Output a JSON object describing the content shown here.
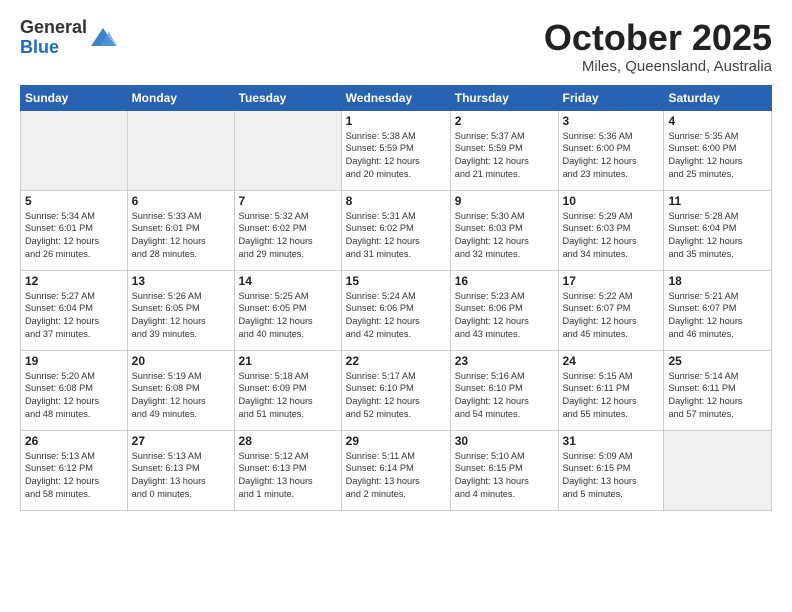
{
  "logo": {
    "general": "General",
    "blue": "Blue"
  },
  "header": {
    "month": "October 2025",
    "location": "Miles, Queensland, Australia"
  },
  "weekdays": [
    "Sunday",
    "Monday",
    "Tuesday",
    "Wednesday",
    "Thursday",
    "Friday",
    "Saturday"
  ],
  "weeks": [
    [
      {
        "day": "",
        "info": ""
      },
      {
        "day": "",
        "info": ""
      },
      {
        "day": "",
        "info": ""
      },
      {
        "day": "1",
        "info": "Sunrise: 5:38 AM\nSunset: 5:59 PM\nDaylight: 12 hours\nand 20 minutes."
      },
      {
        "day": "2",
        "info": "Sunrise: 5:37 AM\nSunset: 5:59 PM\nDaylight: 12 hours\nand 21 minutes."
      },
      {
        "day": "3",
        "info": "Sunrise: 5:36 AM\nSunset: 6:00 PM\nDaylight: 12 hours\nand 23 minutes."
      },
      {
        "day": "4",
        "info": "Sunrise: 5:35 AM\nSunset: 6:00 PM\nDaylight: 12 hours\nand 25 minutes."
      }
    ],
    [
      {
        "day": "5",
        "info": "Sunrise: 5:34 AM\nSunset: 6:01 PM\nDaylight: 12 hours\nand 26 minutes."
      },
      {
        "day": "6",
        "info": "Sunrise: 5:33 AM\nSunset: 6:01 PM\nDaylight: 12 hours\nand 28 minutes."
      },
      {
        "day": "7",
        "info": "Sunrise: 5:32 AM\nSunset: 6:02 PM\nDaylight: 12 hours\nand 29 minutes."
      },
      {
        "day": "8",
        "info": "Sunrise: 5:31 AM\nSunset: 6:02 PM\nDaylight: 12 hours\nand 31 minutes."
      },
      {
        "day": "9",
        "info": "Sunrise: 5:30 AM\nSunset: 6:03 PM\nDaylight: 12 hours\nand 32 minutes."
      },
      {
        "day": "10",
        "info": "Sunrise: 5:29 AM\nSunset: 6:03 PM\nDaylight: 12 hours\nand 34 minutes."
      },
      {
        "day": "11",
        "info": "Sunrise: 5:28 AM\nSunset: 6:04 PM\nDaylight: 12 hours\nand 35 minutes."
      }
    ],
    [
      {
        "day": "12",
        "info": "Sunrise: 5:27 AM\nSunset: 6:04 PM\nDaylight: 12 hours\nand 37 minutes."
      },
      {
        "day": "13",
        "info": "Sunrise: 5:26 AM\nSunset: 6:05 PM\nDaylight: 12 hours\nand 39 minutes."
      },
      {
        "day": "14",
        "info": "Sunrise: 5:25 AM\nSunset: 6:05 PM\nDaylight: 12 hours\nand 40 minutes."
      },
      {
        "day": "15",
        "info": "Sunrise: 5:24 AM\nSunset: 6:06 PM\nDaylight: 12 hours\nand 42 minutes."
      },
      {
        "day": "16",
        "info": "Sunrise: 5:23 AM\nSunset: 6:06 PM\nDaylight: 12 hours\nand 43 minutes."
      },
      {
        "day": "17",
        "info": "Sunrise: 5:22 AM\nSunset: 6:07 PM\nDaylight: 12 hours\nand 45 minutes."
      },
      {
        "day": "18",
        "info": "Sunrise: 5:21 AM\nSunset: 6:07 PM\nDaylight: 12 hours\nand 46 minutes."
      }
    ],
    [
      {
        "day": "19",
        "info": "Sunrise: 5:20 AM\nSunset: 6:08 PM\nDaylight: 12 hours\nand 48 minutes."
      },
      {
        "day": "20",
        "info": "Sunrise: 5:19 AM\nSunset: 6:08 PM\nDaylight: 12 hours\nand 49 minutes."
      },
      {
        "day": "21",
        "info": "Sunrise: 5:18 AM\nSunset: 6:09 PM\nDaylight: 12 hours\nand 51 minutes."
      },
      {
        "day": "22",
        "info": "Sunrise: 5:17 AM\nSunset: 6:10 PM\nDaylight: 12 hours\nand 52 minutes."
      },
      {
        "day": "23",
        "info": "Sunrise: 5:16 AM\nSunset: 6:10 PM\nDaylight: 12 hours\nand 54 minutes."
      },
      {
        "day": "24",
        "info": "Sunrise: 5:15 AM\nSunset: 6:11 PM\nDaylight: 12 hours\nand 55 minutes."
      },
      {
        "day": "25",
        "info": "Sunrise: 5:14 AM\nSunset: 6:11 PM\nDaylight: 12 hours\nand 57 minutes."
      }
    ],
    [
      {
        "day": "26",
        "info": "Sunrise: 5:13 AM\nSunset: 6:12 PM\nDaylight: 12 hours\nand 58 minutes."
      },
      {
        "day": "27",
        "info": "Sunrise: 5:13 AM\nSunset: 6:13 PM\nDaylight: 13 hours\nand 0 minutes."
      },
      {
        "day": "28",
        "info": "Sunrise: 5:12 AM\nSunset: 6:13 PM\nDaylight: 13 hours\nand 1 minute."
      },
      {
        "day": "29",
        "info": "Sunrise: 5:11 AM\nSunset: 6:14 PM\nDaylight: 13 hours\nand 2 minutes."
      },
      {
        "day": "30",
        "info": "Sunrise: 5:10 AM\nSunset: 6:15 PM\nDaylight: 13 hours\nand 4 minutes."
      },
      {
        "day": "31",
        "info": "Sunrise: 5:09 AM\nSunset: 6:15 PM\nDaylight: 13 hours\nand 5 minutes."
      },
      {
        "day": "",
        "info": ""
      }
    ]
  ]
}
